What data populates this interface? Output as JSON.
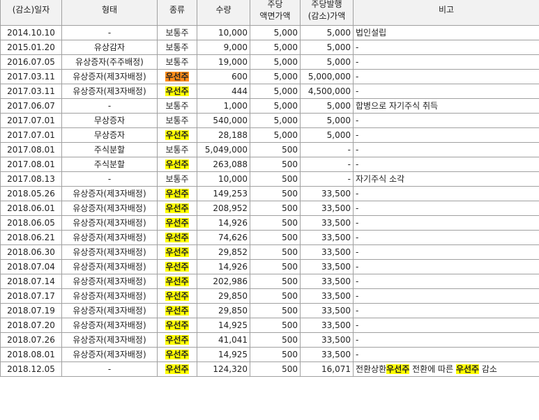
{
  "headers": [
    "(감소)일자",
    "형태",
    "종류",
    "수량",
    "주당\n액면가액",
    "주당발행\n(감소)가액",
    "비고"
  ],
  "rows": [
    {
      "date": "2014.10.10",
      "form": "-",
      "type": "보통주",
      "hl": "",
      "qty": "10,000",
      "par": "5,000",
      "price": "5,000",
      "note": [
        {
          "t": "법인설립",
          "h": false
        }
      ]
    },
    {
      "date": "2015.01.20",
      "form": "유상감자",
      "type": "보통주",
      "hl": "",
      "qty": "9,000",
      "par": "5,000",
      "price": "5,000",
      "note": [
        {
          "t": "-",
          "h": false
        }
      ]
    },
    {
      "date": "2016.07.05",
      "form": "유상증자(주주배정)",
      "type": "보통주",
      "hl": "",
      "qty": "19,000",
      "par": "5,000",
      "price": "5,000",
      "note": [
        {
          "t": "-",
          "h": false
        }
      ]
    },
    {
      "date": "2017.03.11",
      "form": "유상증자(제3자배정)",
      "type": "우선주",
      "hl": "orange",
      "qty": "600",
      "par": "5,000",
      "price": "5,000,000",
      "note": [
        {
          "t": "-",
          "h": false
        }
      ]
    },
    {
      "date": "2017.03.11",
      "form": "유상증자(제3자배정)",
      "type": "우선주",
      "hl": "yellow",
      "qty": "444",
      "par": "5,000",
      "price": "4,500,000",
      "note": [
        {
          "t": "-",
          "h": false
        }
      ]
    },
    {
      "date": "2017.06.07",
      "form": "-",
      "type": "보통주",
      "hl": "",
      "qty": "1,000",
      "par": "5,000",
      "price": "5,000",
      "note": [
        {
          "t": "합병으로 자기주식 취득",
          "h": false
        }
      ]
    },
    {
      "date": "2017.07.01",
      "form": "무상증자",
      "type": "보통주",
      "hl": "",
      "qty": "540,000",
      "par": "5,000",
      "price": "5,000",
      "note": [
        {
          "t": "-",
          "h": false
        }
      ]
    },
    {
      "date": "2017.07.01",
      "form": "무상증자",
      "type": "우선주",
      "hl": "yellow",
      "qty": "28,188",
      "par": "5,000",
      "price": "5,000",
      "note": [
        {
          "t": "-",
          "h": false
        }
      ]
    },
    {
      "date": "2017.08.01",
      "form": "주식분할",
      "type": "보통주",
      "hl": "",
      "qty": "5,049,000",
      "par": "500",
      "price": "-",
      "note": [
        {
          "t": "-",
          "h": false
        }
      ]
    },
    {
      "date": "2017.08.01",
      "form": "주식분할",
      "type": "우선주",
      "hl": "yellow",
      "qty": "263,088",
      "par": "500",
      "price": "-",
      "note": [
        {
          "t": "-",
          "h": false
        }
      ]
    },
    {
      "date": "2017.08.13",
      "form": "-",
      "type": "보통주",
      "hl": "",
      "qty": "10,000",
      "par": "500",
      "price": "-",
      "note": [
        {
          "t": "자기주식 소각",
          "h": false
        }
      ]
    },
    {
      "date": "2018.05.26",
      "form": "유상증자(제3자배정)",
      "type": "우선주",
      "hl": "yellow",
      "qty": "149,253",
      "par": "500",
      "price": "33,500",
      "note": [
        {
          "t": "-",
          "h": false
        }
      ]
    },
    {
      "date": "2018.06.01",
      "form": "유상증자(제3자배정)",
      "type": "우선주",
      "hl": "yellow",
      "qty": "208,952",
      "par": "500",
      "price": "33,500",
      "note": [
        {
          "t": "-",
          "h": false
        }
      ]
    },
    {
      "date": "2018.06.05",
      "form": "유상증자(제3자배정)",
      "type": "우선주",
      "hl": "yellow",
      "qty": "14,926",
      "par": "500",
      "price": "33,500",
      "note": [
        {
          "t": "-",
          "h": false
        }
      ]
    },
    {
      "date": "2018.06.21",
      "form": "유상증자(제3자배정)",
      "type": "우선주",
      "hl": "yellow",
      "qty": "74,626",
      "par": "500",
      "price": "33,500",
      "note": [
        {
          "t": "-",
          "h": false
        }
      ]
    },
    {
      "date": "2018.06.30",
      "form": "유상증자(제3자배정)",
      "type": "우선주",
      "hl": "yellow",
      "qty": "29,852",
      "par": "500",
      "price": "33,500",
      "note": [
        {
          "t": "-",
          "h": false
        }
      ]
    },
    {
      "date": "2018.07.04",
      "form": "유상증자(제3자배정)",
      "type": "우선주",
      "hl": "yellow",
      "qty": "14,926",
      "par": "500",
      "price": "33,500",
      "note": [
        {
          "t": "-",
          "h": false
        }
      ]
    },
    {
      "date": "2018.07.14",
      "form": "유상증자(제3자배정)",
      "type": "우선주",
      "hl": "yellow",
      "qty": "202,986",
      "par": "500",
      "price": "33,500",
      "note": [
        {
          "t": "-",
          "h": false
        }
      ]
    },
    {
      "date": "2018.07.17",
      "form": "유상증자(제3자배정)",
      "type": "우선주",
      "hl": "yellow",
      "qty": "29,850",
      "par": "500",
      "price": "33,500",
      "note": [
        {
          "t": "-",
          "h": false
        }
      ]
    },
    {
      "date": "2018.07.19",
      "form": "유상증자(제3자배정)",
      "type": "우선주",
      "hl": "yellow",
      "qty": "29,850",
      "par": "500",
      "price": "33,500",
      "note": [
        {
          "t": "-",
          "h": false
        }
      ]
    },
    {
      "date": "2018.07.20",
      "form": "유상증자(제3자배정)",
      "type": "우선주",
      "hl": "yellow",
      "qty": "14,925",
      "par": "500",
      "price": "33,500",
      "note": [
        {
          "t": "-",
          "h": false
        }
      ]
    },
    {
      "date": "2018.07.26",
      "form": "유상증자(제3자배정)",
      "type": "우선주",
      "hl": "yellow",
      "qty": "41,041",
      "par": "500",
      "price": "33,500",
      "note": [
        {
          "t": "-",
          "h": false
        }
      ]
    },
    {
      "date": "2018.08.01",
      "form": "유상증자(제3자배정)",
      "type": "우선주",
      "hl": "yellow",
      "qty": "14,925",
      "par": "500",
      "price": "33,500",
      "note": [
        {
          "t": "-",
          "h": false
        }
      ]
    },
    {
      "date": "2018.12.05",
      "form": "-",
      "type": "우선주",
      "hl": "yellow",
      "qty": "124,320",
      "par": "500",
      "price": "16,071",
      "note": [
        {
          "t": "전환상환",
          "h": false
        },
        {
          "t": "우선주",
          "h": true
        },
        {
          "t": " 전환에 따른 ",
          "h": false
        },
        {
          "t": "우선주",
          "h": true
        },
        {
          "t": " 감소",
          "h": false
        }
      ]
    }
  ],
  "colors": {
    "highlight_yellow": "#ffff00",
    "highlight_orange": "#ff8c1a",
    "border": "#a0a0a0",
    "header_bg": "#f2f2f2"
  }
}
